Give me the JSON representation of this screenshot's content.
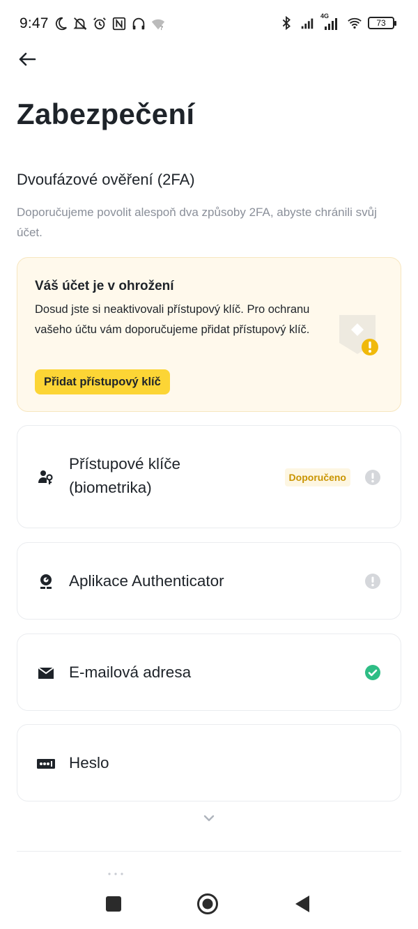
{
  "status_bar": {
    "time": "9:47",
    "network_type": "4G",
    "battery": "73",
    "left_icons": [
      "moon-icon",
      "bell-off-icon",
      "alarm-icon",
      "nfc-icon",
      "headphones-icon",
      "wifi-unknown-icon"
    ],
    "right_icons": [
      "bluetooth-icon",
      "signal-icon",
      "signal-4g-icon",
      "wifi-icon",
      "battery-icon"
    ]
  },
  "header": {
    "back_icon": "arrow-left-icon",
    "title": "Zabezpečení"
  },
  "two_fa": {
    "title": "Dvoufázové ověření (2FA)",
    "description": "Doporučujeme povolit alespoň dva způsoby 2FA, abyste chránili svůj účet."
  },
  "warning_card": {
    "title": "Váš účet je v ohrožení",
    "text": "Dosud jste si neaktivovali přístupový klíč. Pro ochranu vašeho účtu vám doporučujeme přidat přístupový klíč.",
    "button_label": "Přidat přístupový klíč",
    "background_color": "#fff9ec",
    "button_color": "#fcd535",
    "illustration_icon": "key-shield-warning-icon"
  },
  "methods": [
    {
      "label": "Přístupové klíče (biometrika)",
      "icon": "passkey-icon",
      "badge": "Doporučeno",
      "status": "warning",
      "status_icon": "exclamation-circle-icon"
    },
    {
      "label": "Aplikace Authenticator",
      "icon": "authenticator-icon",
      "badge": "",
      "status": "warning",
      "status_icon": "exclamation-circle-icon"
    },
    {
      "label": "E-mailová adresa",
      "icon": "envelope-icon",
      "badge": "",
      "status": "enabled",
      "status_icon": "check-circle-icon"
    },
    {
      "label": "Heslo",
      "icon": "password-icon",
      "badge": "",
      "status": "none",
      "status_icon": ""
    }
  ],
  "expand_icon": "chevron-down-icon",
  "nav_bar": {
    "buttons": [
      "recents-square-icon",
      "home-circle-icon",
      "back-triangle-icon"
    ]
  },
  "colors": {
    "text_primary": "#1e2329",
    "text_secondary": "#8a8f99",
    "accent_yellow": "#fcd535",
    "badge_text": "#c99400",
    "success_green": "#2ebd85",
    "neutral_gray": "#d5d7db",
    "border": "#eaecef"
  }
}
